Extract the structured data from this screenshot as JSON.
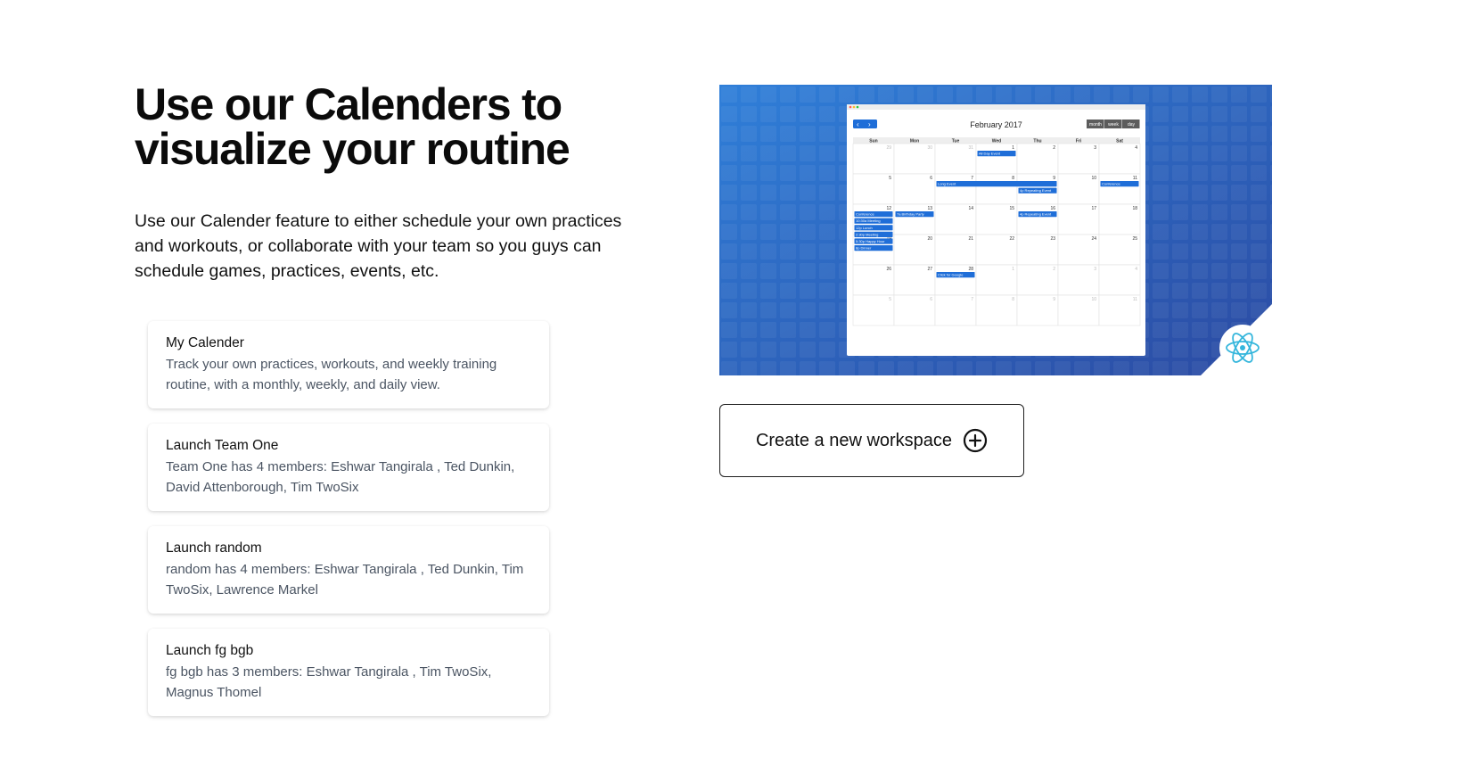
{
  "headline": {
    "line1": "Use our Calenders to",
    "line2": "visualize your routine"
  },
  "intro": "Use our Calender feature to either schedule your own practices and workouts, or collaborate with your team so you guys can schedule games, practices, events, etc.",
  "cards": [
    {
      "title": "My Calender",
      "description": "Track your own practices, workouts, and weekly training routine, with a monthly, weekly, and daily view."
    },
    {
      "title": "Launch Team One",
      "description": "Team One has 4 members: Eshwar Tangirala , Ted Dunkin, David Attenborough, Tim TwoSix"
    },
    {
      "title": "Launch random",
      "description": "random has 4 members: Eshwar Tangirala , Ted Dunkin, Tim TwoSix, Lawrence Markel"
    },
    {
      "title": "Launch fg bgb",
      "description": "fg bgb has 3 members: Eshwar Tangirala , Tim TwoSix, Magnus Thomel"
    }
  ],
  "workspace_button": {
    "label": "Create a new workspace",
    "icon": "plus-circle-icon"
  },
  "hero": {
    "month_label": "February 2017",
    "view_buttons": [
      "month",
      "week",
      "day"
    ],
    "weekdays": [
      "Sun",
      "Mon",
      "Tue",
      "Wed",
      "Thu",
      "Fri",
      "Sat"
    ],
    "weeks": [
      [
        29,
        30,
        31,
        1,
        2,
        3,
        4
      ],
      [
        5,
        6,
        7,
        8,
        9,
        10,
        11
      ],
      [
        12,
        13,
        14,
        15,
        16,
        17,
        18
      ],
      [
        19,
        20,
        21,
        22,
        23,
        24,
        25
      ],
      [
        26,
        27,
        28,
        1,
        2,
        3,
        4
      ],
      [
        5,
        6,
        7,
        8,
        9,
        10,
        11
      ]
    ],
    "events": [
      {
        "label": "All Day Event",
        "week": 0,
        "day": 3,
        "span": 1,
        "slot": 0
      },
      {
        "label": "Long Event",
        "week": 1,
        "day": 2,
        "span": 3,
        "slot": 0
      },
      {
        "label": "Conference",
        "week": 1,
        "day": 6,
        "span": 1,
        "slot": 0
      },
      {
        "label": "4p Repeating Event",
        "week": 1,
        "day": 4,
        "span": 1,
        "slot": 1
      },
      {
        "label": "Conference",
        "week": 2,
        "day": 0,
        "span": 1,
        "slot": 0
      },
      {
        "label": "7a Birthday Party",
        "week": 2,
        "day": 1,
        "span": 1,
        "slot": 0
      },
      {
        "label": "4p Repeating Event",
        "week": 2,
        "day": 4,
        "span": 1,
        "slot": 0
      },
      {
        "label": "10:30a Meeting",
        "week": 2,
        "day": 0,
        "span": 1,
        "slot": 1
      },
      {
        "label": "12p Lunch",
        "week": 2,
        "day": 0,
        "span": 1,
        "slot": 2
      },
      {
        "label": "2:30p Meeting",
        "week": 2,
        "day": 0,
        "span": 1,
        "slot": 3
      },
      {
        "label": "5:30p Happy Hour",
        "week": 2,
        "day": 0,
        "span": 1,
        "slot": 4
      },
      {
        "label": "8p Dinner",
        "week": 2,
        "day": 0,
        "span": 1,
        "slot": 5
      },
      {
        "label": "Click for Google",
        "week": 4,
        "day": 2,
        "span": 1,
        "slot": 0
      }
    ],
    "colors": {
      "gradient_start": "#2f7fd9",
      "gradient_end": "#2b4aa2",
      "event_blue": "#1f6ed8",
      "react_cyan": "#35b6dc"
    },
    "badge_icon": "react-logo-icon"
  }
}
